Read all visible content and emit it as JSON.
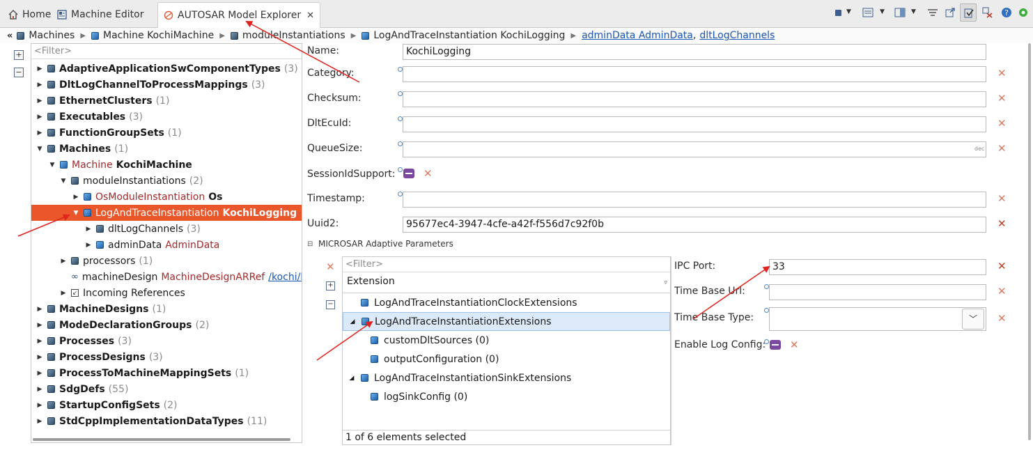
{
  "tabs": [
    {
      "label": "Home"
    },
    {
      "label": "Machine Editor"
    },
    {
      "label": "AUTOSAR Model Explorer"
    }
  ],
  "breadcrumb": {
    "items": [
      "Machines",
      "Machine KochiMachine",
      "moduleInstantiations",
      "LogAndTraceInstantiation KochiLogging"
    ],
    "links": [
      "adminData AdminData",
      "dltLogChannels"
    ],
    "link_separator": ","
  },
  "tree": {
    "filter_placeholder": "<Filter>",
    "rows": [
      {
        "name": "AdaptiveApplicationSwComponentTypes",
        "count": "(3)"
      },
      {
        "name": "DltLogChannelToProcessMappings",
        "count": "(3)"
      },
      {
        "name": "EthernetClusters",
        "count": "(1)"
      },
      {
        "name": "Executables",
        "count": "(3)"
      },
      {
        "name": "FunctionGroupSets",
        "count": "(1)"
      },
      {
        "name": "Machines",
        "count": "(1)"
      },
      {
        "type": "Machine",
        "name": "KochiMachine"
      },
      {
        "name": "moduleInstantiations",
        "count": "(2)"
      },
      {
        "type": "OsModuleInstantiation",
        "name": "Os"
      },
      {
        "type": "LogAndTraceInstantiation",
        "name": "KochiLogging"
      },
      {
        "name": "dltLogChannels",
        "count": "(3)"
      },
      {
        "name": "adminData",
        "type": "AdminData"
      },
      {
        "name": "processors",
        "count": "(1)"
      },
      {
        "name": "machineDesign",
        "type": "MachineDesignARRef",
        "link": "/kochi/Ma"
      },
      {
        "name": "Incoming References"
      },
      {
        "name": "MachineDesigns",
        "count": "(1)"
      },
      {
        "name": "ModeDeclarationGroups",
        "count": "(2)"
      },
      {
        "name": "Processes",
        "count": "(3)"
      },
      {
        "name": "ProcessDesigns",
        "count": "(3)"
      },
      {
        "name": "ProcessToMachineMappingSets",
        "count": "(1)"
      },
      {
        "name": "SdgDefs",
        "count": "(55)"
      },
      {
        "name": "StartupConfigSets",
        "count": "(2)"
      },
      {
        "name": "StdCppImplementationDataTypes",
        "count": "(11)"
      }
    ]
  },
  "form": {
    "name_label": "Name:",
    "name_value": "KochiLogging",
    "category_label": "Category:",
    "category_value": "",
    "checksum_label": "Checksum:",
    "checksum_value": "",
    "dltecuid_label": "DltEcuId:",
    "dltecuid_value": "",
    "queuesize_label": "QueueSize:",
    "queuesize_value": "",
    "queuesize_hint": "dec",
    "sessionid_label": "SessionIdSupport:",
    "timestamp_label": "Timestamp:",
    "timestamp_value": "",
    "uuid_label": "Uuid2:",
    "uuid_value": "95677ec4-3947-4cfe-a42f-f556d7c92f0b"
  },
  "microsar": {
    "section_title": "MICROSAR Adaptive Parameters",
    "filter_placeholder": "<Filter>",
    "column_header": "Extension",
    "rows": [
      {
        "label": "LogAndTraceInstantiationClockExtensions"
      },
      {
        "label": "LogAndTraceInstantiationExtensions"
      },
      {
        "label": "customDltSources (0)"
      },
      {
        "label": "outputConfiguration (0)"
      },
      {
        "label": "LogAndTraceInstantiationSinkExtensions"
      },
      {
        "label": "logSinkConfig (0)"
      }
    ],
    "status": "1 of 6 elements selected"
  },
  "ipc": {
    "ipc_port_label": "IPC Port:",
    "ipc_port_value": "33",
    "time_base_url_label": "Time Base Url:",
    "time_base_url_value": "",
    "time_base_type_label": "Time Base Type:",
    "time_base_type_value": "",
    "enable_log_config_label": "Enable Log Config:"
  },
  "colors": {
    "selection": "#e9572b",
    "type_text": "#a3282a",
    "link": "#1b56b5",
    "annotation_arrow": "#e0231e"
  }
}
